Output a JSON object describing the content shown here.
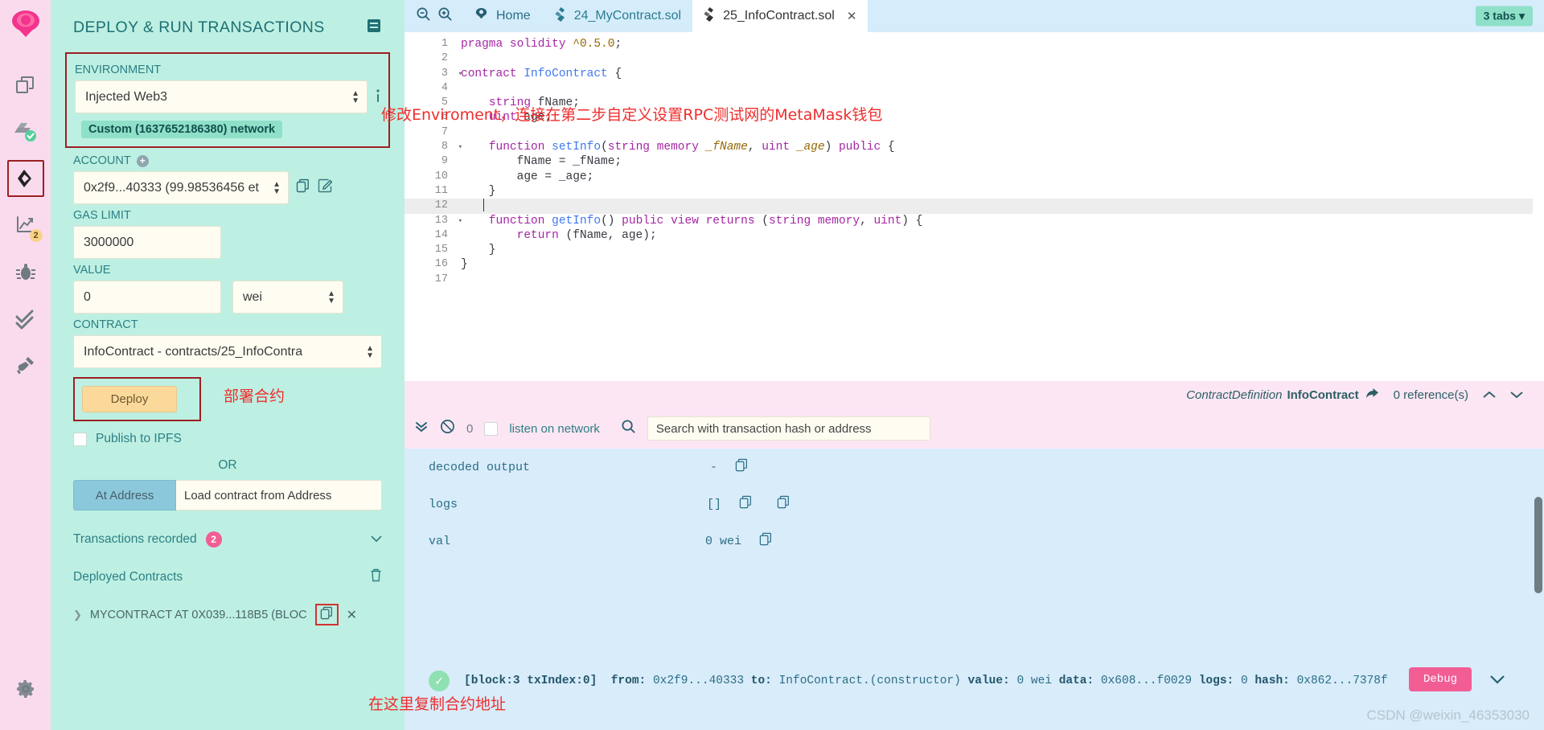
{
  "iconbar": {
    "logo": "remix-logo-icon",
    "items": [
      {
        "name": "file-explorer-icon",
        "badge": null
      },
      {
        "name": "solidity-compiler-icon",
        "badge": null
      },
      {
        "name": "deploy-run-transactions-icon",
        "badge": null,
        "selected": true
      },
      {
        "name": "analysis-icon",
        "badge": "2"
      },
      {
        "name": "debugger-icon",
        "badge": null
      },
      {
        "name": "unit-testing-icon",
        "badge": null
      },
      {
        "name": "plugin-manager-icon",
        "badge": null
      }
    ],
    "settings": {
      "name": "settings-gear-icon"
    }
  },
  "panel": {
    "title": "DEPLOY & RUN TRANSACTIONS",
    "header_icon": "panel-notes-icon",
    "environment": {
      "label": "ENVIRONMENT",
      "value": "Injected Web3",
      "info_icon": "info-icon",
      "network_badge": "Custom (1637652186380) network"
    },
    "account": {
      "label": "ACCOUNT",
      "add_icon": "plus-circle-icon",
      "value": "0x2f9...40333 (99.98536456 et",
      "copy_icon": "copy-icon",
      "sign_icon": "edit-sign-icon"
    },
    "gas_limit": {
      "label": "GAS LIMIT",
      "value": "3000000"
    },
    "value": {
      "label": "VALUE",
      "amount": "0",
      "unit": "wei"
    },
    "contract": {
      "label": "CONTRACT",
      "value": "InfoContract - contracts/25_InfoContra"
    },
    "deploy": {
      "label": "Deploy",
      "annotation": "部署合约"
    },
    "publish_ipfs": {
      "label": "Publish to IPFS",
      "checked": false
    },
    "or": "OR",
    "at_address": {
      "button": "At Address",
      "placeholder": "Load contract from Address"
    },
    "transactions_recorded": {
      "label": "Transactions recorded",
      "count": "2"
    },
    "deployed_contracts": {
      "label": "Deployed Contracts",
      "trash_icon": "trash-icon"
    },
    "deployed_item": {
      "caret_icon": "chevron-right-icon",
      "label": "MYCONTRACT AT 0X039...118B5 (BLOC",
      "copy_icon": "copy-icon",
      "close_icon": "close-icon",
      "annotation": "在这里复制合约地址"
    }
  },
  "tabbar": {
    "zoom_out_icon": "zoom-out-icon",
    "zoom_in_icon": "zoom-in-icon",
    "home_icon": "remix-home-icon",
    "home_label": "Home",
    "tabs": [
      {
        "label": "24_MyContract.sol",
        "icon": "solidity-file-icon",
        "active": false,
        "closable": false
      },
      {
        "label": "25_InfoContract.sol",
        "icon": "solidity-file-icon",
        "active": true,
        "closable": true
      }
    ],
    "tabs_count": "3 tabs"
  },
  "editor": {
    "lines": [
      {
        "n": "1",
        "fold": false,
        "cur": false,
        "tokens": [
          {
            "c": "k",
            "t": "pragma"
          },
          {
            "c": "p",
            "t": " "
          },
          {
            "c": "k",
            "t": "solidity"
          },
          {
            "c": "p",
            "t": " "
          },
          {
            "c": "num",
            "t": "^0.5.0"
          },
          {
            "c": "p",
            "t": ";"
          }
        ]
      },
      {
        "n": "2",
        "fold": false,
        "cur": false,
        "tokens": []
      },
      {
        "n": "3",
        "fold": true,
        "cur": false,
        "tokens": [
          {
            "c": "k",
            "t": "contract"
          },
          {
            "c": "p",
            "t": " "
          },
          {
            "c": "t",
            "t": "InfoContract"
          },
          {
            "c": "p",
            "t": " {"
          }
        ]
      },
      {
        "n": "4",
        "fold": false,
        "cur": false,
        "tokens": []
      },
      {
        "n": "5",
        "fold": false,
        "cur": false,
        "tokens": [
          {
            "c": "p",
            "t": "    "
          },
          {
            "c": "k",
            "t": "string"
          },
          {
            "c": "p",
            "t": " fName;"
          }
        ]
      },
      {
        "n": "6",
        "fold": false,
        "cur": false,
        "tokens": [
          {
            "c": "p",
            "t": "    "
          },
          {
            "c": "k",
            "t": "uint"
          },
          {
            "c": "p",
            "t": " age;"
          }
        ]
      },
      {
        "n": "7",
        "fold": false,
        "cur": false,
        "tokens": []
      },
      {
        "n": "8",
        "fold": true,
        "cur": false,
        "tokens": [
          {
            "c": "p",
            "t": "    "
          },
          {
            "c": "k",
            "t": "function"
          },
          {
            "c": "p",
            "t": " "
          },
          {
            "c": "t",
            "t": "setInfo"
          },
          {
            "c": "p",
            "t": "("
          },
          {
            "c": "k",
            "t": "string"
          },
          {
            "c": "p",
            "t": " "
          },
          {
            "c": "k",
            "t": "memory"
          },
          {
            "c": "p",
            "t": " "
          },
          {
            "c": "n",
            "t": "_fName"
          },
          {
            "c": "p",
            "t": ", "
          },
          {
            "c": "k",
            "t": "uint"
          },
          {
            "c": "p",
            "t": " "
          },
          {
            "c": "n",
            "t": "_age"
          },
          {
            "c": "p",
            "t": ") "
          },
          {
            "c": "k",
            "t": "public"
          },
          {
            "c": "p",
            "t": " {"
          }
        ]
      },
      {
        "n": "9",
        "fold": false,
        "cur": false,
        "tokens": [
          {
            "c": "p",
            "t": "        fName = _fName;"
          }
        ]
      },
      {
        "n": "10",
        "fold": false,
        "cur": false,
        "tokens": [
          {
            "c": "p",
            "t": "        age = _age;"
          }
        ]
      },
      {
        "n": "11",
        "fold": false,
        "cur": false,
        "tokens": [
          {
            "c": "p",
            "t": "    }"
          }
        ]
      },
      {
        "n": "12",
        "fold": false,
        "cur": true,
        "tokens": []
      },
      {
        "n": "13",
        "fold": true,
        "cur": false,
        "tokens": [
          {
            "c": "p",
            "t": "    "
          },
          {
            "c": "k",
            "t": "function"
          },
          {
            "c": "p",
            "t": " "
          },
          {
            "c": "t",
            "t": "getInfo"
          },
          {
            "c": "p",
            "t": "() "
          },
          {
            "c": "k",
            "t": "public"
          },
          {
            "c": "p",
            "t": " "
          },
          {
            "c": "k",
            "t": "view"
          },
          {
            "c": "p",
            "t": " "
          },
          {
            "c": "k",
            "t": "returns"
          },
          {
            "c": "p",
            "t": " ("
          },
          {
            "c": "k",
            "t": "string"
          },
          {
            "c": "p",
            "t": " "
          },
          {
            "c": "k",
            "t": "memory"
          },
          {
            "c": "p",
            "t": ", "
          },
          {
            "c": "k",
            "t": "uint"
          },
          {
            "c": "p",
            "t": ") {"
          }
        ]
      },
      {
        "n": "14",
        "fold": false,
        "cur": false,
        "tokens": [
          {
            "c": "p",
            "t": "        "
          },
          {
            "c": "k",
            "t": "return"
          },
          {
            "c": "p",
            "t": " (fName, age);"
          }
        ]
      },
      {
        "n": "15",
        "fold": false,
        "cur": false,
        "tokens": [
          {
            "c": "p",
            "t": "    }"
          }
        ]
      },
      {
        "n": "16",
        "fold": false,
        "cur": false,
        "tokens": [
          {
            "c": "p",
            "t": "}"
          }
        ]
      },
      {
        "n": "17",
        "fold": false,
        "cur": false,
        "tokens": []
      }
    ],
    "annotation": "修改Enviroment，连接在第二步自定义设置RPC测试网的MetaMask钱包"
  },
  "contract_def_bar": {
    "prefix": "ContractDefinition",
    "name": "InfoContract",
    "jump_icon": "jump-to-icon",
    "references": "0 reference(s)",
    "up_icon": "chevron-up-icon",
    "down_icon": "chevron-down-icon"
  },
  "terminal": {
    "collapse_icon": "double-chevron-down-icon",
    "clear_icon": "ban-clear-icon",
    "count": "0",
    "listen_label": "listen on network",
    "listen_checked": false,
    "search_icon": "search-icon",
    "search_placeholder": "Search with transaction hash or address",
    "rows": [
      {
        "key": "decoded output",
        "value": "-",
        "copies": 1
      },
      {
        "key": "logs",
        "value": "[]",
        "copies": 2
      },
      {
        "key": "val",
        "value": "0 wei",
        "copies": 1
      }
    ],
    "copy_icon": "copy-icon",
    "tx": {
      "status_icon": "check-circle-icon",
      "block": "[block:3 txIndex:0]",
      "from_label": "from:",
      "from": "0x2f9...40333",
      "to_label": "to:",
      "to": "InfoContract.(constructor)",
      "value_label": "value:",
      "value": "0 wei",
      "data_label": "data:",
      "data": "0x608...f0029",
      "logs_label": "logs:",
      "logs": "0",
      "hash_label": "hash:",
      "hash": "0x862...7378f",
      "debug_label": "Debug",
      "expand_icon": "chevron-down-icon"
    },
    "watermark": "CSDN @weixin_46353030"
  },
  "colors": {
    "panel_bg": "#bdf0e2",
    "iconbar_bg": "#fadbee",
    "accent_pink": "#f25d94",
    "annotation_red": "#ef2d2d",
    "terminal_bg": "#d8ecfa",
    "tabbar_bg": "#d5ecfb",
    "highlight_box": "#9c1f22"
  }
}
